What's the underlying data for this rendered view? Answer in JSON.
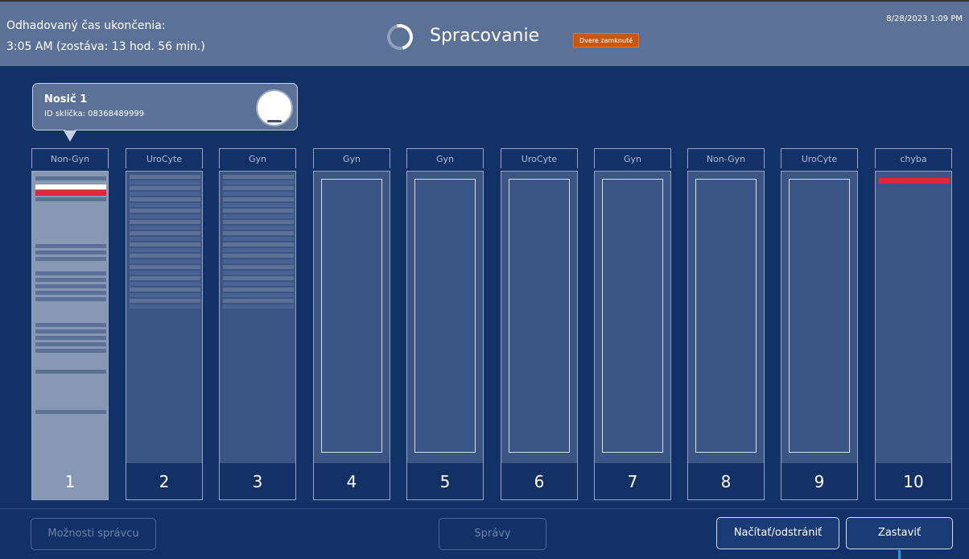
{
  "header": {
    "estimated_label": "Odhadovaný čas ukončenia:",
    "estimated_value": "3:05 AM (zostáva: 13 hod. 56 min.)",
    "title": "Spracovanie",
    "door_status": "Dvere zamknuté",
    "datetime": "8/28/2023 1:09 PM",
    "colors": {
      "background": "#5c7196",
      "door_badge": "#c9580f"
    }
  },
  "tooltip": {
    "title": "Nosič 1",
    "slide_id": "ID sklíčka: 08368489999"
  },
  "racks": [
    {
      "type": "Non-Gyn",
      "number": "1",
      "state": "selected"
    },
    {
      "type": "UroCyte",
      "number": "2",
      "state": "loaded"
    },
    {
      "type": "Gyn",
      "number": "3",
      "state": "loaded"
    },
    {
      "type": "Gyn",
      "number": "4",
      "state": "empty"
    },
    {
      "type": "Gyn",
      "number": "5",
      "state": "empty"
    },
    {
      "type": "UroCyte",
      "number": "6",
      "state": "empty"
    },
    {
      "type": "Gyn",
      "number": "7",
      "state": "empty"
    },
    {
      "type": "Non-Gyn",
      "number": "8",
      "state": "empty"
    },
    {
      "type": "UroCyte",
      "number": "9",
      "state": "empty"
    },
    {
      "type": "chyba",
      "number": "10",
      "state": "error"
    }
  ],
  "footer": {
    "admin_options": "Možnosti správcu",
    "messages": "Správy",
    "load_remove": "Načítať/odstrániť",
    "stop": "Zastaviť"
  },
  "colors": {
    "page_background": "#123167",
    "error_red": "#e0253f"
  }
}
